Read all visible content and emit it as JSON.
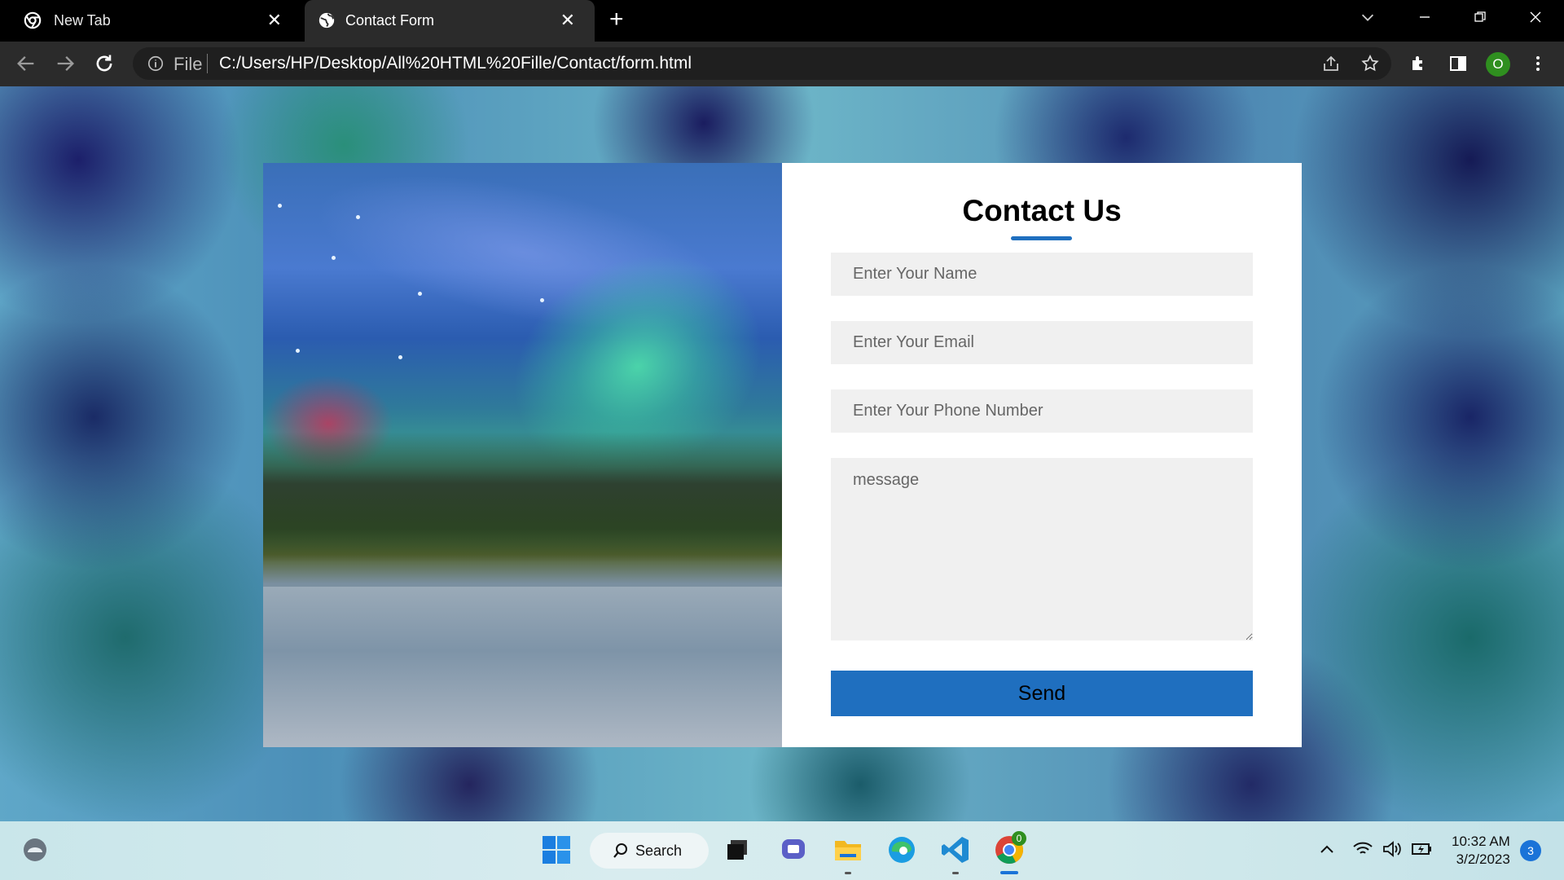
{
  "browser": {
    "tabs": [
      {
        "title": "New Tab",
        "icon": "chrome-icon"
      },
      {
        "title": "Contact Form",
        "icon": "globe-icon",
        "active": true
      }
    ],
    "address": {
      "scheme_label": "File",
      "url": "C:/Users/HP/Desktop/All%20HTML%20Fille/Contact/form.html"
    },
    "profile_initial": "O"
  },
  "form": {
    "title": "Contact Us",
    "name_placeholder": "Enter Your Name",
    "email_placeholder": "Enter Your Email",
    "phone_placeholder": "Enter Your Phone Number",
    "message_placeholder": "message",
    "send_label": "Send",
    "accent_color": "#1f6fbf"
  },
  "taskbar": {
    "search_label": "Search",
    "time": "10:32 AM",
    "date": "3/2/2023",
    "notification_count": "3",
    "chrome_badge": "0"
  }
}
